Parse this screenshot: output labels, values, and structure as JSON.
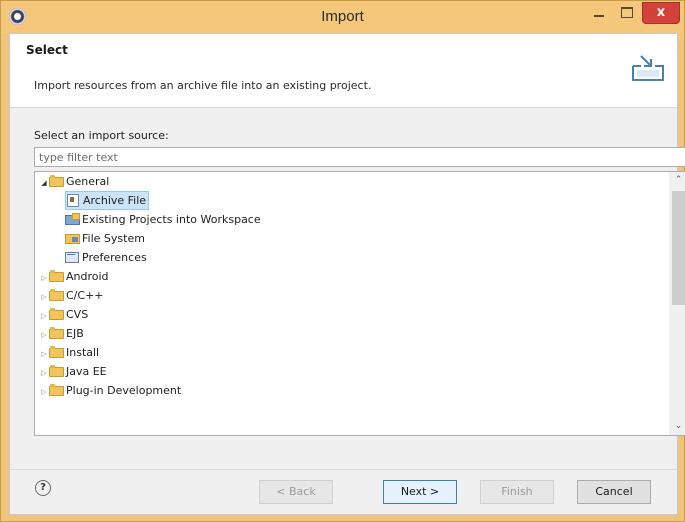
{
  "window": {
    "title": "Import",
    "close_glyph": "x"
  },
  "banner": {
    "title": "Select",
    "description": "Import resources from an archive file into an existing project.",
    "icon": "import-wizard-icon"
  },
  "source": {
    "label": "Select an import source:",
    "filter_placeholder": "type filter text"
  },
  "tree": {
    "items": [
      {
        "label": "General",
        "expanded": true,
        "icon": "folder-icon"
      },
      {
        "label": "Archive File",
        "selected": true,
        "icon": "archive-file-icon"
      },
      {
        "label": "Existing Projects into Workspace",
        "icon": "projects-icon"
      },
      {
        "label": "File System",
        "icon": "file-system-icon"
      },
      {
        "label": "Preferences",
        "icon": "preferences-icon"
      },
      {
        "label": "Android",
        "expanded": false,
        "icon": "folder-icon"
      },
      {
        "label": "C/C++",
        "expanded": false,
        "icon": "folder-icon"
      },
      {
        "label": "CVS",
        "expanded": false,
        "icon": "folder-icon"
      },
      {
        "label": "EJB",
        "expanded": false,
        "icon": "folder-icon"
      },
      {
        "label": "Install",
        "expanded": false,
        "icon": "folder-icon"
      },
      {
        "label": "Java EE",
        "expanded": false,
        "icon": "folder-icon"
      },
      {
        "label": "Plug-in Development",
        "expanded": false,
        "icon": "folder-icon"
      }
    ]
  },
  "footer": {
    "help": "?",
    "back": "< Back",
    "next": "Next >",
    "finish": "Finish",
    "cancel": "Cancel"
  },
  "colors": {
    "titlebar": "#f5c77b",
    "close_button": "#d2423a",
    "selection": "#cce4f7"
  }
}
